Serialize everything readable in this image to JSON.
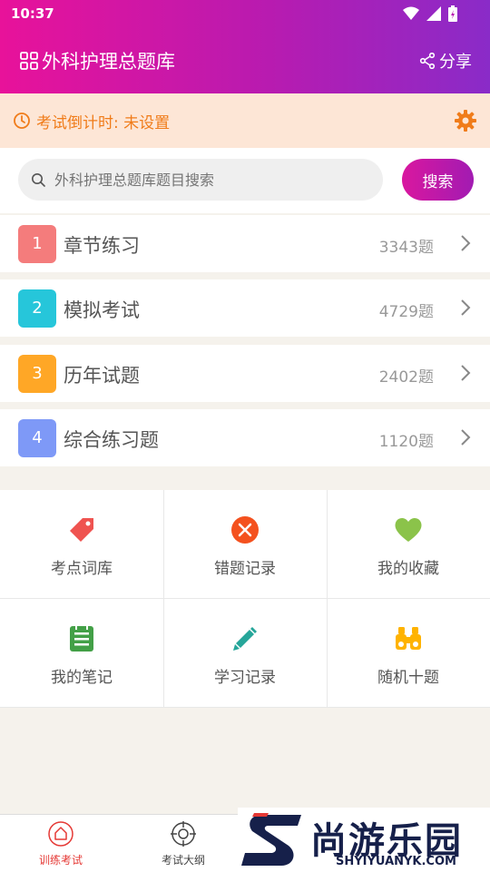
{
  "status_bar": {
    "time": "10:37"
  },
  "app_bar": {
    "title": "外科护理总题库",
    "share_label": "分享"
  },
  "countdown": {
    "text": "考试倒计时: 未设置"
  },
  "search": {
    "placeholder": "外科护理总题库题目搜索",
    "button_label": "搜索"
  },
  "categories": [
    {
      "num": "1",
      "name": "章节练习",
      "count": "3343题",
      "color": "#f47c7c"
    },
    {
      "num": "2",
      "name": "模拟考试",
      "count": "4729题",
      "color": "#26c6da"
    },
    {
      "num": "3",
      "name": "历年试题",
      "count": "2402题",
      "color": "#ffa726"
    },
    {
      "num": "4",
      "name": "综合练习题",
      "count": "1120题",
      "color": "#7e99f7"
    }
  ],
  "tools": [
    {
      "label": "考点词库",
      "icon": "tag-icon",
      "color": "#ef5350"
    },
    {
      "label": "错题记录",
      "icon": "error-icon",
      "color": "#f4511e"
    },
    {
      "label": "我的收藏",
      "icon": "heart-icon",
      "color": "#8bc34a"
    },
    {
      "label": "我的笔记",
      "icon": "notebook-icon",
      "color": "#43a047"
    },
    {
      "label": "学习记录",
      "icon": "pencil-icon",
      "color": "#26a69a"
    },
    {
      "label": "随机十题",
      "icon": "binoculars-icon",
      "color": "#ffb300"
    }
  ],
  "bottom_nav": [
    {
      "label": "训练考试",
      "icon": "home-icon",
      "active": true
    },
    {
      "label": "考试大纲",
      "icon": "target-icon",
      "active": false
    }
  ],
  "watermark": {
    "title": "尚游乐园",
    "subtitle": "SHYIYUANYK.COM"
  },
  "colors": {
    "accent": "#d9179f",
    "active_nav": "#e53935",
    "countdown_text": "#f07c1a"
  }
}
